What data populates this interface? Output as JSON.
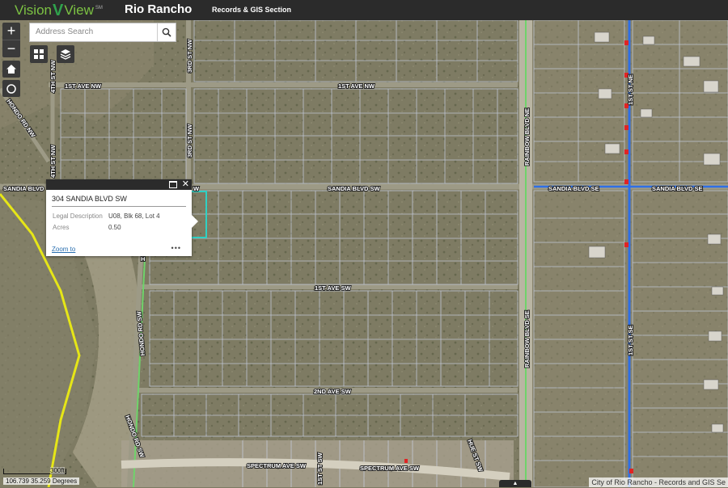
{
  "header": {
    "logo_left": "Vision",
    "logo_mark": "V",
    "logo_right": "View",
    "logo_tm": "SM",
    "city": "Rio Rancho",
    "section": "Records & GIS Section"
  },
  "search": {
    "placeholder": "Address Search"
  },
  "controls": {
    "zoom_in": "+",
    "zoom_out": "−"
  },
  "popup": {
    "title": "304 SANDIA BLVD SW",
    "fields": [
      {
        "label": "Legal Description",
        "value": "U08, Blk 68, Lot 4"
      },
      {
        "label": "Acres",
        "value": "0.50"
      }
    ],
    "zoom_link": "Zoom to",
    "more": "•••",
    "close": "✕"
  },
  "street_labels": {
    "first_ave_nw_a": "1ST AVE NW",
    "first_ave_nw_b": "1ST AVE NW",
    "fourth_st_nw": "4TH ST NW",
    "third_st_nw": "3RD ST NW",
    "third_st_nw_b": "3RD ST NW",
    "hondo_rd_nw": "HONDO RD NW",
    "fourth_st_nw_b": "4TH ST NW",
    "sandia_blvd_w": "SANDIA BLVD",
    "sandia_blvd_sw": "SANDIA BLVD SW",
    "sandia_blvd_se": "SANDIA BLVD SE",
    "sandia_blvd_se_b": "SANDIA BLVD SE",
    "rainbow_blvd_ne": "RAINBOW BLVD NE",
    "rainbow_blvd_se": "RAINBOW BLVD SE",
    "first_st_ne": "1ST ST NE",
    "first_st_se": "1ST ST SE",
    "first_ave_sw": "1ST AVE SW",
    "second_ave_sw": "2ND AVE SW",
    "hondo_rd_sw": "HONDO RD SW",
    "hondo_rd_sw_b": "HONDO RD SW",
    "spectrum_ave_sw_a": "SPECTRUM AVE SW",
    "spectrum_ave_sw_b": "SPECTRUM AVE SW",
    "first_st_sw": "1ST ST SW",
    "hue_st_sw": "HUE ST SW",
    "w_fragment": "W",
    "h_fragment": "H"
  },
  "scale": {
    "label": "300ft"
  },
  "coordinates": "106.739 35.259 Degrees",
  "attribution": "City of Rio Rancho - Records and GIS Se",
  "colors": {
    "header_bg": "#2b2b2b",
    "logo_green": "#7cc243",
    "parcel_line": "#c9d1e6",
    "selected_parcel": "#2fd1c4",
    "city_boundary": "#e6e617",
    "road_green": "#6fd36b",
    "blue_road": "#2f6fe6",
    "hydrant": "#e02424"
  },
  "icons": [
    "plus-icon",
    "minus-icon",
    "home-icon",
    "locate-icon",
    "search-icon",
    "basemap-grid-icon",
    "layers-icon",
    "maximize-icon",
    "close-icon",
    "more-icon",
    "chevron-up-icon"
  ]
}
